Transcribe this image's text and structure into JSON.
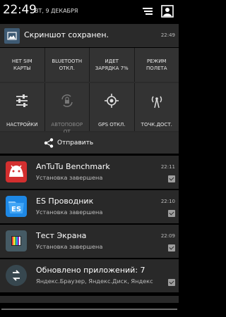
{
  "status_bar": {
    "clock": "22:49",
    "date": "ВТ, 9 ДЕКАБРЯ"
  },
  "screenshot_notification": {
    "title": "Скриншот сохранен.",
    "time": "22:49",
    "icon": "image-icon"
  },
  "quick_settings": {
    "row1": [
      {
        "label": "НЕТ SIM\nКАРТЫ"
      },
      {
        "label": "BLUETOOTH\nОТКЛ."
      },
      {
        "label": "ИДЕТ\nЗАРЯДКА 7%"
      },
      {
        "label": "РЕЖИМ\nПОЛЕТА"
      }
    ],
    "row2": [
      {
        "label": "НАСТРОЙКИ",
        "icon": "sliders-icon"
      },
      {
        "label": "АВТОПОВОР\nОТ",
        "icon": "rotate-lock-icon"
      },
      {
        "label": "GPS ОТКЛ.",
        "icon": "gps-icon"
      },
      {
        "label": "ТОЧК.ДОСТ.\n",
        "icon": "hotspot-icon"
      }
    ]
  },
  "share": {
    "label": "Отправить",
    "icon": "share-icon"
  },
  "notifications": [
    {
      "name": "AnTuTu Benchmark",
      "sub": "Установка завершена",
      "time": "22:11",
      "icon_color": "#e53935"
    },
    {
      "name": "ES Проводник",
      "sub": "Установка завершена",
      "time": "22:10",
      "icon_color": "#1e88e5"
    },
    {
      "name": "Тест Экрана",
      "sub": "Установка завершена",
      "time": "22:09",
      "icon_color": "#546e7a"
    },
    {
      "name": "Обновлено приложений: 7",
      "sub": "Яндекс.Браузер, Яндекс.Диск, Яндекс",
      "time": "",
      "icon_color": "#37474f"
    }
  ]
}
